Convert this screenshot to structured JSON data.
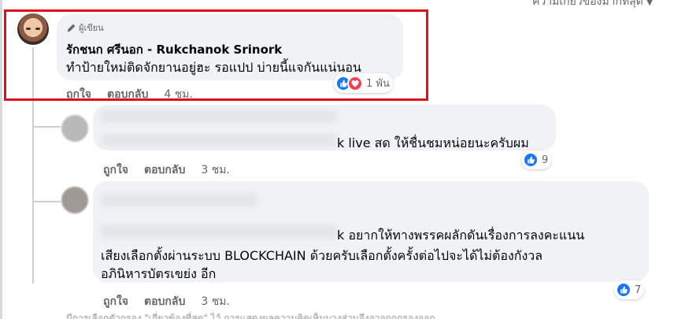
{
  "header": {
    "sort_label": "ความเกี่ยวข้องมากที่สุด"
  },
  "main_comment": {
    "badge": "ผู้เขียน",
    "author": "รักชนก ศรีนอก - Rukchanok Srinork",
    "text": "ทำป้ายใหม่ติดจักยานอยู่ฮะ รอแปป บ่ายนี้แจกันแน่นอน",
    "like_label": "ถูกใจ",
    "reply_label": "ตอบกลับ",
    "time": "4 ชม.",
    "reactions": {
      "count": "1 พัน",
      "types": [
        "like-icon",
        "love-icon"
      ]
    }
  },
  "replies": [
    {
      "text_visible": "k live สด ให้ชื่นชมหน่อยนะครับผม",
      "like_label": "ถูกใจ",
      "reply_label": "ตอบกลับ",
      "time": "3 ชม.",
      "reactions": {
        "count": "9",
        "types": [
          "like-icon"
        ]
      }
    },
    {
      "line1_visible": "k อยากให้ทางพรรคผลักดันเรื่องการลงคะแนน",
      "line2": "เสียงเลือกตั้งผ่านระบบ BLOCKCHAIN ด้วยครับเลือกตั้งครั้งต่อไปจะได้ไม่ต้องกังวล",
      "line3": "อภินิหารบัตรเขย่ง อีก",
      "like_label": "ถูกใจ",
      "reply_label": "ตอบกลับ",
      "time": "3 ชม.",
      "reactions": {
        "count": "7",
        "types": [
          "like-icon"
        ]
      }
    }
  ],
  "footer": {
    "text": "มีการเลือกตัวกรอง \"เกี่ยวข้องที่สุด\" ไว้ การแสดงผลความคิดเห็นบางส่วนจึงอาจถูกกรองออก"
  },
  "colors": {
    "highlight": "#e0101a",
    "like": "#1877f2",
    "love": "#f33e58",
    "bubble": "#f0f2f5"
  }
}
